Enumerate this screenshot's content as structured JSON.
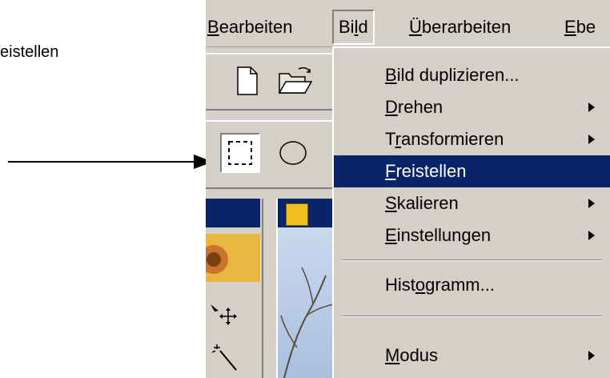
{
  "caption": "eistellen",
  "menubar": {
    "items": [
      {
        "mnemonic": "B",
        "rest": "earbeiten"
      },
      {
        "pre": "Bi",
        "mnemonic": "l",
        "rest": "d"
      },
      {
        "mnemonic": "Ü",
        "rest": "berarbeiten"
      },
      {
        "mnemonic": "E",
        "rest": "be"
      }
    ]
  },
  "dropdown": {
    "items": [
      {
        "mnemonic": "B",
        "rest": "ild duplizieren...",
        "submenu": false
      },
      {
        "mnemonic": "D",
        "rest": "rehen",
        "submenu": true
      },
      {
        "pre": "T",
        "mnemonic": "r",
        "rest": "ansformieren",
        "submenu": true
      },
      {
        "mnemonic": "F",
        "rest": "reistellen",
        "submenu": false,
        "highlighted": true
      },
      {
        "mnemonic": "S",
        "rest": "kalieren",
        "submenu": true
      },
      {
        "mnemonic": "E",
        "rest": "instellungen",
        "submenu": true
      },
      {
        "pre": "Hist",
        "mnemonic": "o",
        "rest": "gramm...",
        "submenu": false
      },
      {
        "mnemonic": "M",
        "rest": "odus",
        "submenu": true
      }
    ]
  },
  "colors": {
    "menu_bg": "#d4d0c8",
    "highlight_bg": "#0a246a",
    "highlight_text": "#ffffff"
  }
}
